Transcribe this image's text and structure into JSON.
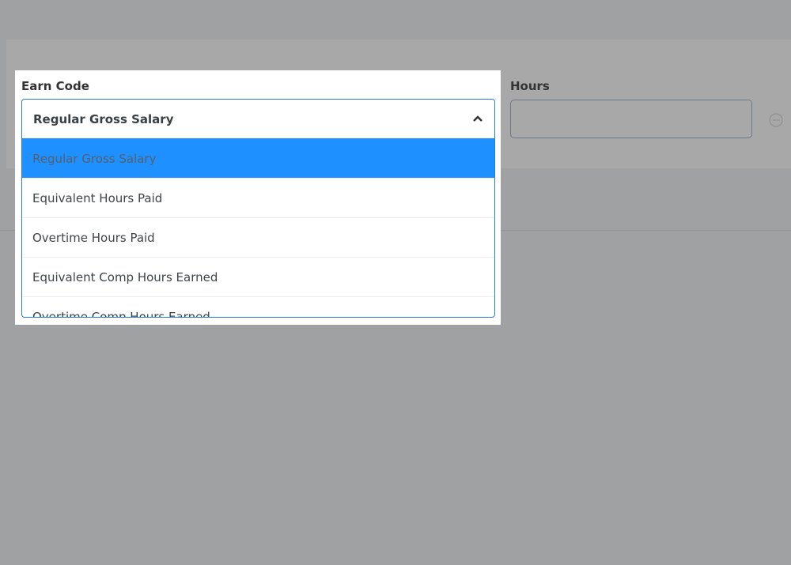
{
  "earn_code": {
    "label": "Earn Code",
    "selected": "Regular Gross Salary",
    "options": [
      "Regular Gross Salary",
      "Equivalent Hours Paid",
      "Overtime Hours Paid",
      "Equivalent Comp Hours Earned",
      "Overtime Comp Hours Earned"
    ],
    "highlight_color": "#1e90ff"
  },
  "hours": {
    "label": "Hours",
    "value": ""
  },
  "icons": {
    "dropdown": "chevron-up-icon",
    "remove": "minus-circle-icon"
  }
}
